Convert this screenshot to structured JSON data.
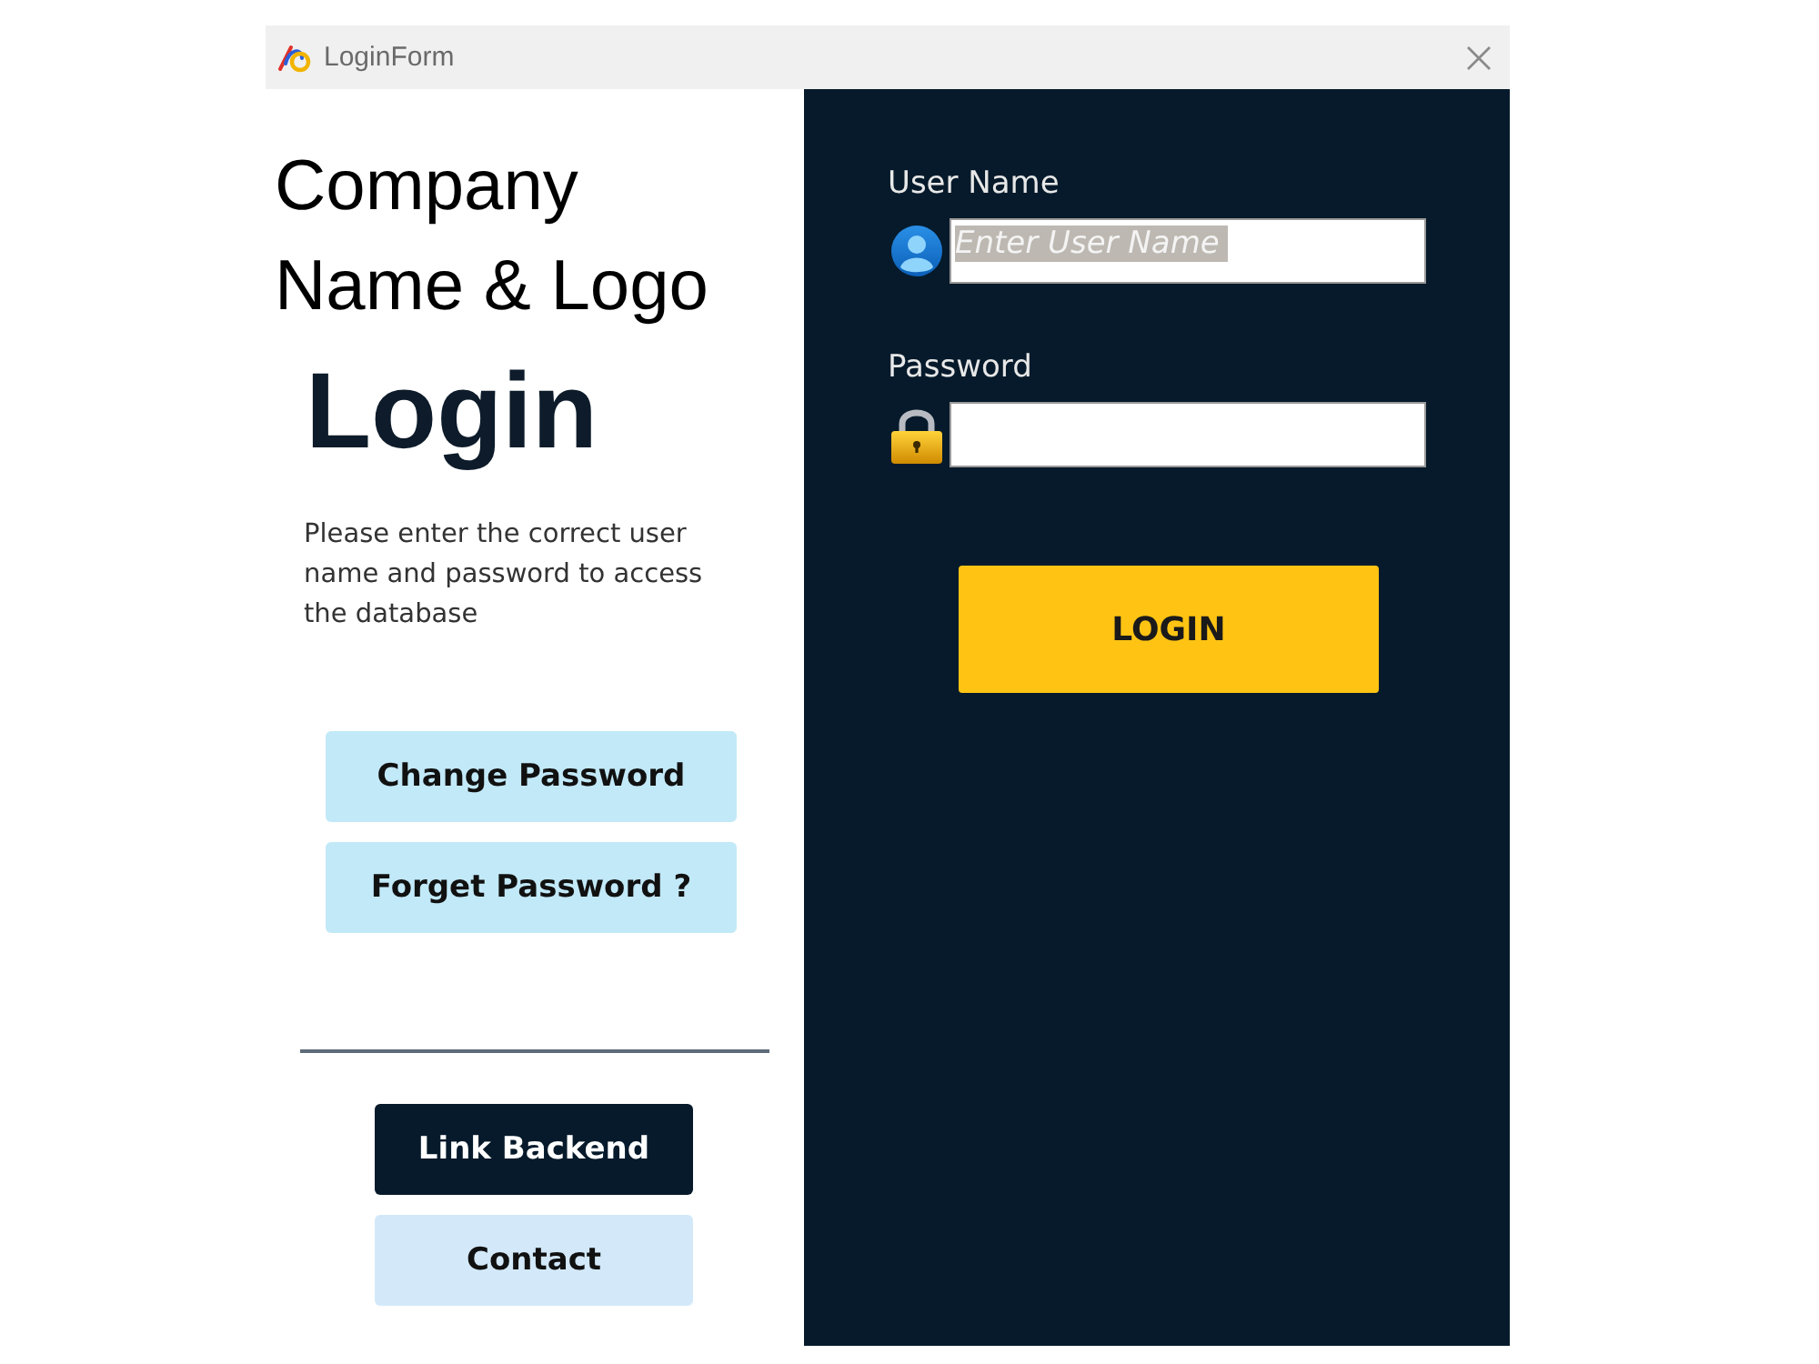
{
  "window": {
    "title": "LoginForm"
  },
  "branding": {
    "company_lines": [
      "Company",
      "Name & Logo"
    ],
    "heading": "Login",
    "description": "Please enter the correct user name and password to access the database"
  },
  "side_buttons": [
    {
      "label": "Change Password"
    },
    {
      "label": "Forget Password ?"
    }
  ],
  "bottom_buttons": [
    {
      "label": "Link Backend",
      "kind": "dark"
    },
    {
      "label": "Contact",
      "kind": "pale"
    }
  ],
  "fields": [
    {
      "label": "User Name",
      "kind": "user",
      "placeholder": "Enter User Name"
    },
    {
      "label": "Password",
      "kind": "password"
    }
  ],
  "login_button": {
    "label": "LOGIN"
  }
}
